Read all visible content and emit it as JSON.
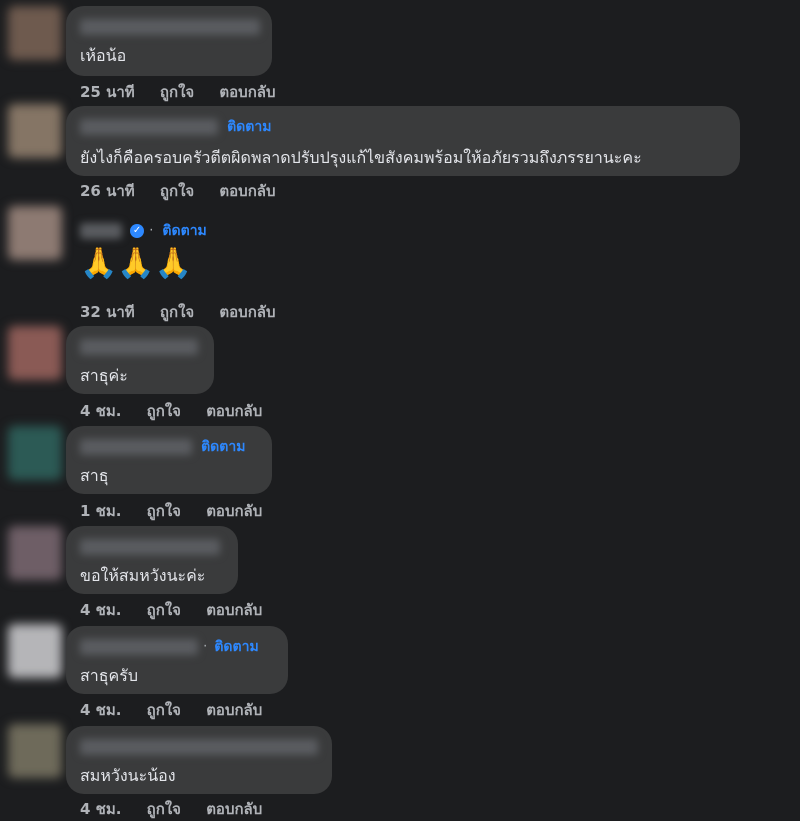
{
  "comments": [
    {
      "text": "เห้อน้อ",
      "time": "25 นาที",
      "like": "ถูกใจ",
      "reply": "ตอบกลับ",
      "follow": "",
      "avatar_color": "#6e5a4e",
      "emoji_count": 0
    },
    {
      "text": "ยังไงก็คือครอบครัวตีตผิดพลาดปรับปรุงแก้ไขสังคมพร้อมให้อภัยรวมถึงภรรยานะคะ",
      "time": "26 นาที",
      "like": "ถูกใจ",
      "reply": "ตอบกลับ",
      "follow": "ติดตาม",
      "avatar_color": "#857565",
      "emoji_count": 0
    },
    {
      "text": "",
      "time": "32 นาที",
      "like": "ถูกใจ",
      "reply": "ตอบกลับ",
      "follow": "ติดตาม",
      "separator": "·",
      "verified_icon": "verified-check-icon",
      "emoji": "🙏",
      "emoji_count": 3,
      "avatar_color": "#8d7a72"
    },
    {
      "text": "สาธุค่ะ",
      "time": "4 ชม.",
      "like": "ถูกใจ",
      "reply": "ตอบกลับ",
      "follow": "",
      "avatar_color": "#8a5a55",
      "emoji_count": 0
    },
    {
      "text": "สาธุ",
      "time": "1 ชม.",
      "like": "ถูกใจ",
      "reply": "ตอบกลับ",
      "follow": "ติดตาม",
      "avatar_color": "#2c5a55",
      "emoji_count": 0
    },
    {
      "text": "ขอให้สมหวังนะค่ะ",
      "time": "4 ชม.",
      "like": "ถูกใจ",
      "reply": "ตอบกลับ",
      "follow": "",
      "avatar_color": "#6e5e66",
      "emoji_count": 0
    },
    {
      "text": "สาธุครับ",
      "time": "4 ชม.",
      "like": "ถูกใจ",
      "reply": "ตอบกลับ",
      "follow": "ติดตาม",
      "separator": "·",
      "avatar_color": "#b5b5b8",
      "emoji_count": 0
    },
    {
      "text": "สมหวังนะน้อง",
      "time": "4 ชม.",
      "like": "ถูกใจ",
      "reply": "ตอบกลับ",
      "follow": "",
      "avatar_color": "#6e6a5a",
      "emoji_count": 0
    }
  ],
  "colors": {
    "background": "#1c1d1f",
    "bubble": "#3a3b3c",
    "link": "#2d88ff",
    "muted": "#b0b3b8"
  }
}
